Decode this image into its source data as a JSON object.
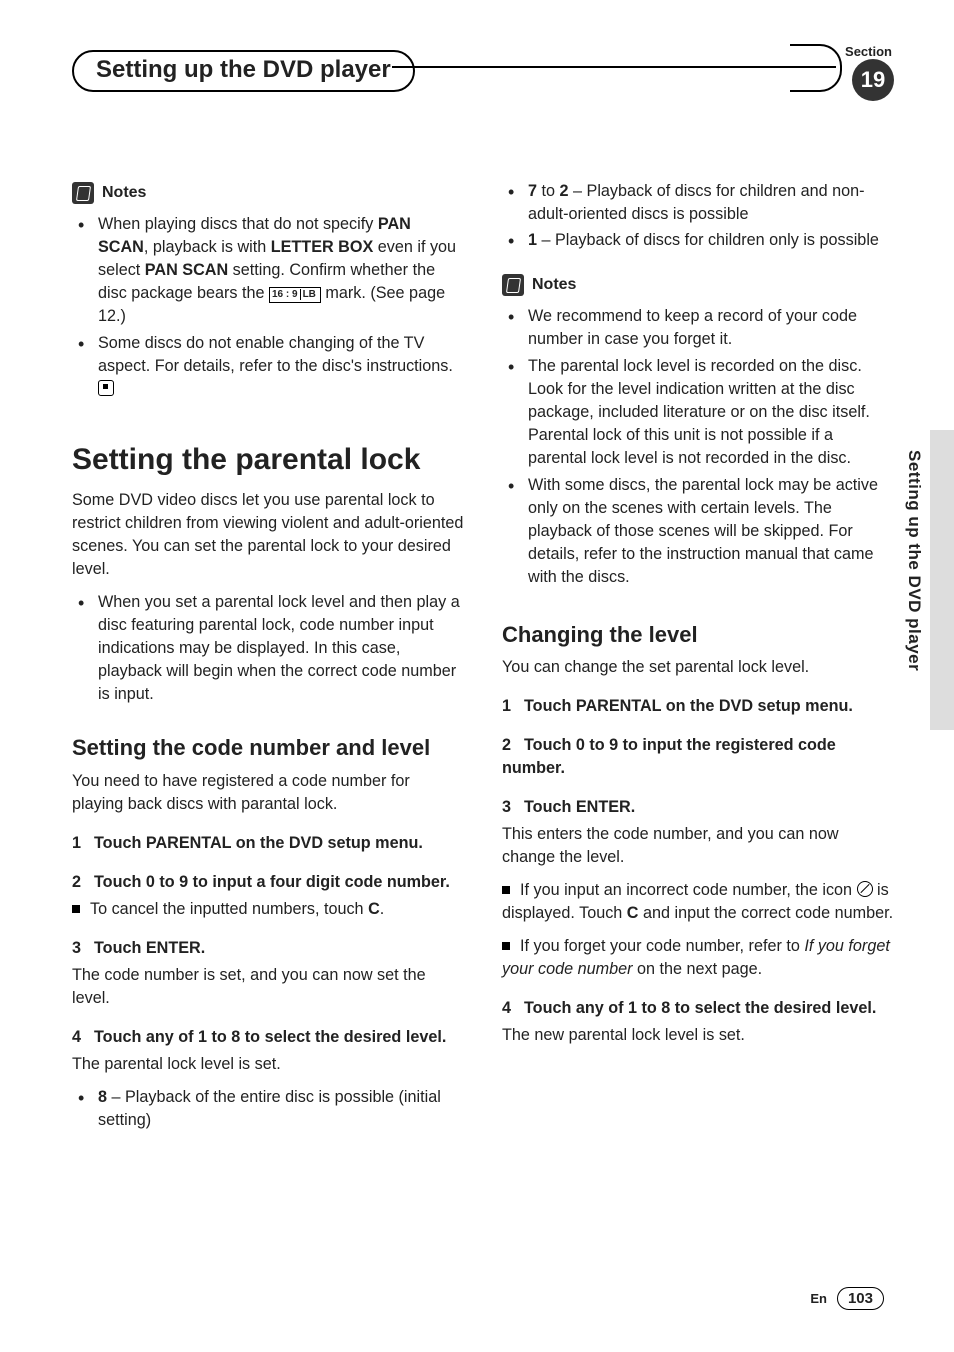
{
  "header": {
    "section_label": "Section",
    "title": "Setting up the DVD player",
    "section_number": "19"
  },
  "side_label": "Setting up the DVD player",
  "footer": {
    "lang": "En",
    "page": "103"
  },
  "left": {
    "notes_label": "Notes",
    "notes": {
      "n1a": "When playing discs that do not specify ",
      "n1b": "PAN SCAN",
      "n1c": ", playback is with ",
      "n1d": "LETTER BOX",
      "n1e": " even if you select ",
      "n1f": "PAN SCAN",
      "n1g": " setting. Confirm whether the disc package bears the ",
      "mark_a": "16 : 9",
      "mark_b": "LB",
      "n1h": " mark. (See page 12.)",
      "n2": "Some discs do not enable changing of the TV aspect. For details, refer to the disc's instructions."
    },
    "h1": "Setting the parental lock",
    "p1": "Some DVD video discs let you use parental lock to restrict children from viewing violent and adult-oriented scenes. You can set the parental lock to your desired level.",
    "b1": "When you set a parental lock level and then play a disc featuring parental lock, code number input indications may be displayed. In this case, playback will begin when the correct code number is input.",
    "h2": "Setting the code number and level",
    "p2": "You need to have registered a code number for playing back discs with parantal lock.",
    "s1": "Touch PARENTAL on the DVD setup menu.",
    "s2": "Touch 0 to 9 to input a four digit code number.",
    "s2n_a": "To cancel the inputted numbers, touch ",
    "s2n_b": "C",
    "s2n_c": ".",
    "s3": "Touch ENTER.",
    "s3p": "The code number is set, and you can now set the level.",
    "s4": "Touch any of 1 to 8 to select the desired level.",
    "s4p": "The parental lock level is set.",
    "lvl8_a": "8",
    "lvl8_b": " – Playback of the entire disc is possible (initial setting)"
  },
  "right": {
    "lvl72_a": "7",
    "lvl72_b": " to ",
    "lvl72_c": "2",
    "lvl72_d": " – Playback of discs for children and non-adult-oriented discs is possible",
    "lvl1_a": "1",
    "lvl1_b": " – Playback of discs for children only is possible",
    "notes_label": "Notes",
    "rn1": "We recommend to keep a record of your code number in case you forget it.",
    "rn2": "The parental lock level is recorded on the disc. Look for the level indication written at the disc package, included literature or on the disc itself. Parental lock of this unit is not possible if a parental lock level is not recorded in the disc.",
    "rn3": "With some discs, the parental lock may be active only on the scenes with certain levels. The playback of those scenes will be skipped. For details, refer to the instruction manual that came with the discs.",
    "h2": "Changing the level",
    "p1": "You can change the set parental lock level.",
    "s1": "Touch PARENTAL on the DVD setup menu.",
    "s2": "Touch 0 to 9 to input the registered code number.",
    "s3": "Touch ENTER.",
    "s3p": "This enters the code number, and you can now change the level.",
    "s3n1_a": "If you input an incorrect code number, the icon ",
    "s3n1_b": " is displayed. Touch ",
    "s3n1_c": "C",
    "s3n1_d": " and input the correct code number.",
    "s3n2_a": "If you forget your code number, refer to ",
    "s3n2_b": "If you forget your code number",
    "s3n2_c": " on the next page.",
    "s4": "Touch any of 1 to 8 to select the desired level.",
    "s4p": "The new parental lock level is set."
  }
}
